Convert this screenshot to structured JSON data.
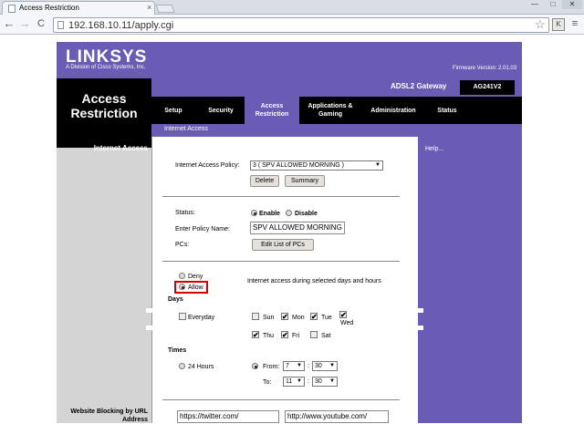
{
  "browser": {
    "tab_title": "Access Restriction",
    "tab_close": "×",
    "url": "192.168.10.11/apply.cgi",
    "back_glyph": "←",
    "forward_glyph": "→",
    "reload_glyph": "C",
    "star_glyph": "☆",
    "menu_glyph": "≡",
    "ext_label": "K",
    "win_min": "—",
    "win_max": "□",
    "win_close": "✕"
  },
  "header": {
    "logo": "LINKSYS",
    "logo_sub": "A Division of Cisco Systems, Inc.",
    "firmware": "Firmware Version: 2.01.03",
    "product": "ADSL2 Gateway",
    "model": "AG241V2",
    "page_title": "Access Restriction"
  },
  "tabs": [
    {
      "label": "Setup"
    },
    {
      "label": "Security"
    },
    {
      "label": "Access Restriction"
    },
    {
      "label": "Applications & Gaming"
    },
    {
      "label": "Administration"
    },
    {
      "label": "Status"
    }
  ],
  "subtab": "Internet Access",
  "left": {
    "section": "Internet Access",
    "section2": "Website Blocking by URL Address"
  },
  "help": "Help...",
  "form": {
    "policy_label": "Internet Access Policy:",
    "policy_value": "3 ( SPV ALLOWED MORNING )",
    "delete_label": "Delete",
    "summary_label": "Summary",
    "status_label": "Status:",
    "enable_label": "Enable",
    "disable_label": "Disable",
    "policy_name_label": "Enter Policy Name:",
    "policy_name_value": "SPV ALLOWED MORNING",
    "pcs_label": "PCs:",
    "edit_pcs_label": "Edit List of PCs",
    "deny_label": "Deny",
    "allow_label": "Allow",
    "access_desc": "Internet access during selected days and hours",
    "days_label": "Days",
    "everyday_label": "Everyday",
    "sun": "Sun",
    "mon": "Mon",
    "tue": "Tue",
    "wed": "Wed",
    "thu": "Thu",
    "fri": "Fri",
    "sat": "Sat",
    "times_label": "Times",
    "hours24_label": "24 Hours",
    "from_label": "From:",
    "to_label": "To:",
    "from_hour": "7",
    "from_min": "30",
    "to_hour": "11",
    "to_min": "30",
    "colon": ":",
    "url1": "https://twitter.com/",
    "url2": "http://www.youtube.com/"
  },
  "checkmark": "✔",
  "arrow": "▼"
}
